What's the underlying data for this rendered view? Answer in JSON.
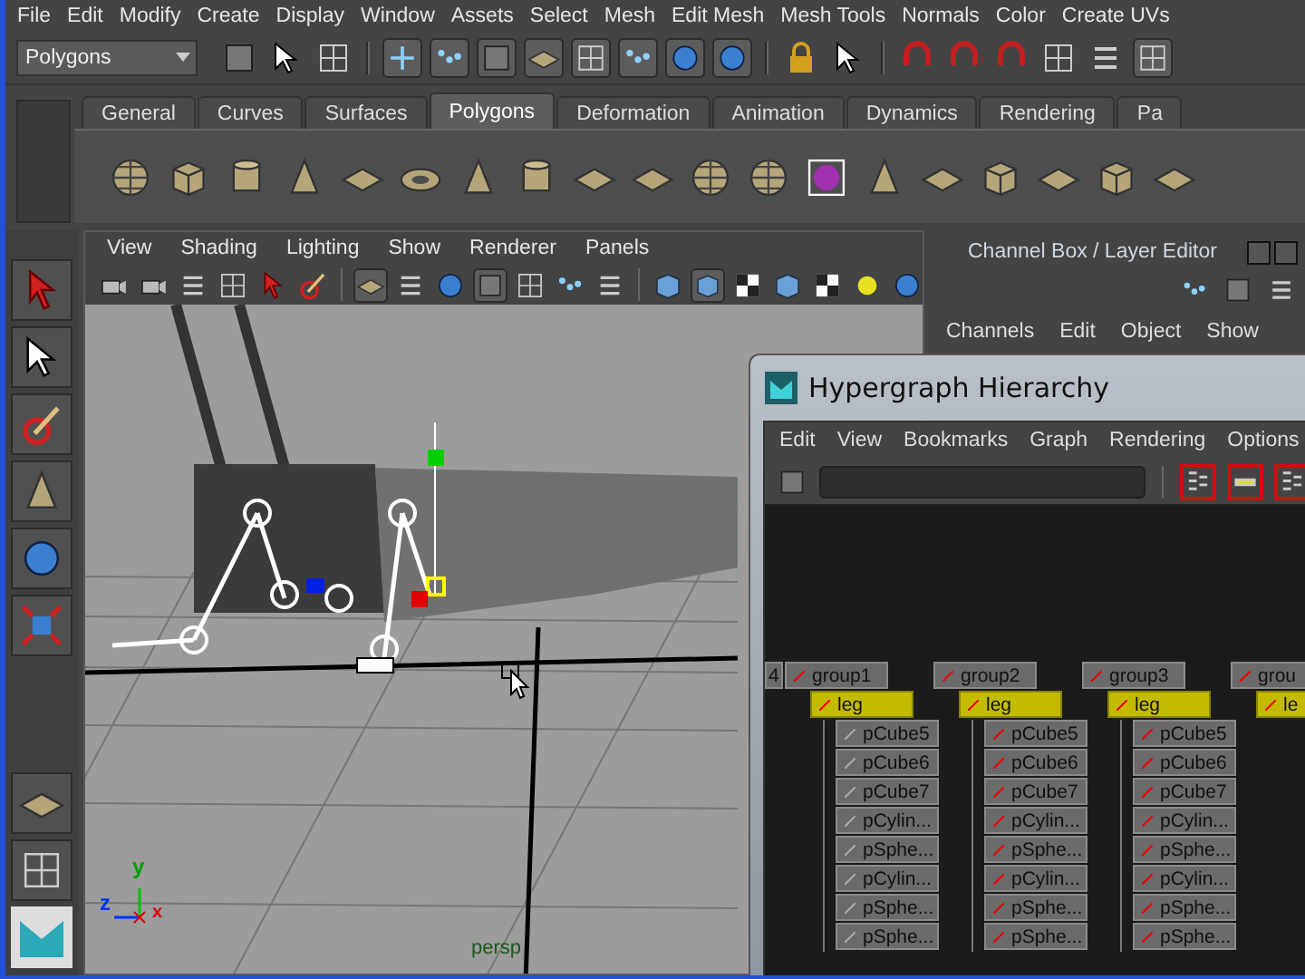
{
  "menubar": [
    "File",
    "Edit",
    "Modify",
    "Create",
    "Display",
    "Window",
    "Assets",
    "Select",
    "Mesh",
    "Edit Mesh",
    "Mesh Tools",
    "Normals",
    "Color",
    "Create UVs"
  ],
  "status_line": {
    "mode": "Polygons"
  },
  "shelf": {
    "tabs": [
      {
        "label": "General",
        "selected": false
      },
      {
        "label": "Curves",
        "selected": false
      },
      {
        "label": "Surfaces",
        "selected": false
      },
      {
        "label": "Polygons",
        "selected": true
      },
      {
        "label": "Deformation",
        "selected": false
      },
      {
        "label": "Animation",
        "selected": false
      },
      {
        "label": "Dynamics",
        "selected": false
      },
      {
        "label": "Rendering",
        "selected": false
      },
      {
        "label": "Pa",
        "selected": false
      }
    ]
  },
  "viewport": {
    "menu": [
      "View",
      "Shading",
      "Lighting",
      "Show",
      "Renderer",
      "Panels"
    ],
    "axis_labels": [
      "y",
      "z",
      "x"
    ],
    "camera": "persp"
  },
  "channel_box": {
    "title": "Channel Box / Layer Editor",
    "menu": [
      "Channels",
      "Edit",
      "Object",
      "Show"
    ]
  },
  "hypergraph": {
    "title": "Hypergraph Hierarchy",
    "menu": [
      "Edit",
      "View",
      "Bookmarks",
      "Graph",
      "Rendering",
      "Options"
    ],
    "partial_node": "4",
    "columns": [
      {
        "group": "group1",
        "leg": "leg",
        "children": [
          "pCube5",
          "pCube6",
          "pCube7",
          "pCylin...",
          "pSphe...",
          "pCylin...",
          "pSphe...",
          "pSphe..."
        ]
      },
      {
        "group": "group2",
        "leg": "leg",
        "children": [
          "pCube5",
          "pCube6",
          "pCube7",
          "pCylin...",
          "pSphe...",
          "pCylin...",
          "pSphe...",
          "pSphe..."
        ]
      },
      {
        "group": "group3",
        "leg": "leg",
        "children": [
          "pCube5",
          "pCube6",
          "pCube7",
          "pCylin...",
          "pSphe...",
          "pCylin...",
          "pSphe...",
          "pSphe..."
        ]
      },
      {
        "group": "grou",
        "leg": "le"
      }
    ]
  }
}
